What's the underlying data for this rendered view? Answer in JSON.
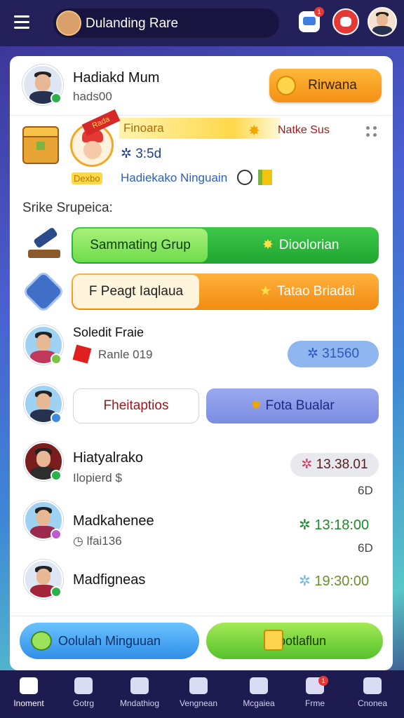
{
  "header": {
    "title": "Dulanding Rare",
    "notification_count": "1"
  },
  "profile": {
    "name": "Hadiakd Mum",
    "subtitle": "hads00",
    "reward_button": "Rirwana"
  },
  "featured": {
    "ribbon": "Rada",
    "banner": "Finoara",
    "side_label": "Natke Sus",
    "stat": "3:5d",
    "tag": "Dexbo",
    "line": "Hadiekako Ninguain"
  },
  "section": {
    "heading": "Srike Srupeica:"
  },
  "rows": [
    {
      "left_label": "Sammating Grup",
      "right_label": "Dioolorian"
    },
    {
      "left_label": "F Peagt Iaqlaua",
      "right_label": "Tatao Briadai"
    }
  ],
  "players": [
    {
      "name": "Soledit Fraie",
      "subtitle": "Ranle 019",
      "chip": "31560"
    },
    {
      "left_button": "Fheitaptios",
      "right_button": "Fota Bualar"
    },
    {
      "name": "Hiatyalrako",
      "subtitle": "Ilopierd $",
      "time": "13.38.01",
      "count": "6D"
    },
    {
      "name": "Madkahenee",
      "subtitle": "lfai136",
      "time": "13:18:00",
      "count": "6D"
    },
    {
      "name": "Madfigneas",
      "time": "19:30:00"
    }
  ],
  "actions": {
    "left": "Oolulah Minguuan",
    "right": "Bapotlaflun"
  },
  "nav": [
    {
      "label": "Inoment",
      "icon": "home-icon"
    },
    {
      "label": "Gotrg",
      "icon": "shop-icon"
    },
    {
      "label": "Mndathiog",
      "icon": "smile-icon"
    },
    {
      "label": "Vengnean",
      "icon": "cross-icon"
    },
    {
      "label": "Mcgaiea",
      "icon": "book-icon"
    },
    {
      "label": "Frme",
      "icon": "chat-icon",
      "badge": "1"
    },
    {
      "label": "Cnonea",
      "icon": "person-icon"
    }
  ],
  "colors": {
    "accent_orange": "#f39015",
    "accent_green": "#1ea631",
    "nav_bg": "#1e1b50"
  }
}
